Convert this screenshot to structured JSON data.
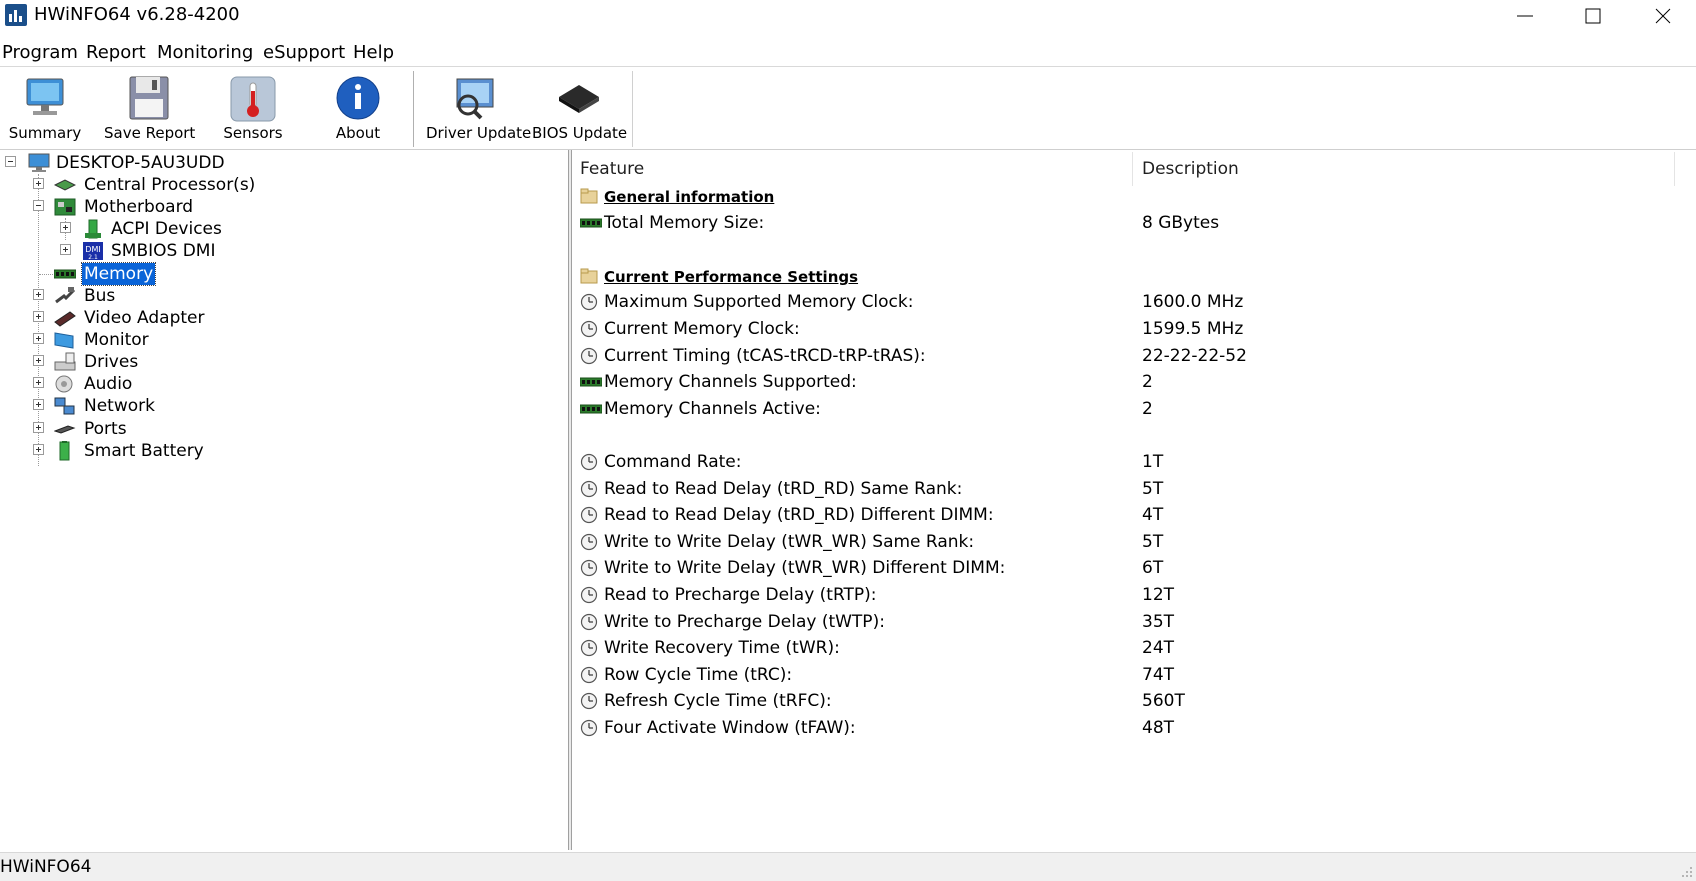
{
  "window": {
    "title": "HWiNFO64 v6.28-4200"
  },
  "menu": [
    "Program",
    "Report",
    "Monitoring",
    "eSupport",
    "Help"
  ],
  "toolbar": {
    "summary": "Summary",
    "save_report": "Save Report",
    "sensors": "Sensors",
    "about": "About",
    "driver_update": "Driver Update",
    "bios_update": "BIOS Update"
  },
  "tree": {
    "root": "DESKTOP-5AU3UDD",
    "items": [
      {
        "label": "Central Processor(s)",
        "icon": "cpu-icon"
      },
      {
        "label": "Motherboard",
        "icon": "motherboard-icon"
      },
      {
        "label": "ACPI Devices",
        "icon": "acpi-icon"
      },
      {
        "label": "SMBIOS DMI",
        "icon": "dmi-icon"
      },
      {
        "label": "Memory",
        "icon": "memory-icon",
        "selected": true
      },
      {
        "label": "Bus",
        "icon": "bus-icon"
      },
      {
        "label": "Video Adapter",
        "icon": "video-adapter-icon"
      },
      {
        "label": "Monitor",
        "icon": "monitor-icon"
      },
      {
        "label": "Drives",
        "icon": "drives-icon"
      },
      {
        "label": "Audio",
        "icon": "audio-icon"
      },
      {
        "label": "Network",
        "icon": "network-icon"
      },
      {
        "label": "Ports",
        "icon": "ports-icon"
      },
      {
        "label": "Smart Battery",
        "icon": "battery-icon"
      }
    ]
  },
  "details": {
    "columns": {
      "feature": "Feature",
      "description": "Description"
    },
    "rows": [
      {
        "type": "section",
        "feature": "General information",
        "icon": "folder-icon"
      },
      {
        "type": "item",
        "feature": "Total Memory Size:",
        "description": "8 GBytes",
        "icon": "memory-icon"
      },
      {
        "type": "blank"
      },
      {
        "type": "section",
        "feature": "Current Performance Settings",
        "icon": "folder-icon"
      },
      {
        "type": "item",
        "feature": "Maximum Supported Memory Clock:",
        "description": "1600.0 MHz",
        "icon": "clock-icon"
      },
      {
        "type": "item",
        "feature": "Current Memory Clock:",
        "description": "1599.5 MHz",
        "icon": "clock-icon"
      },
      {
        "type": "item",
        "feature": "Current Timing (tCAS-tRCD-tRP-tRAS):",
        "description": "22-22-22-52",
        "icon": "clock-icon"
      },
      {
        "type": "item",
        "feature": "Memory Channels Supported:",
        "description": "2",
        "icon": "memory-icon"
      },
      {
        "type": "item",
        "feature": "Memory Channels Active:",
        "description": "2",
        "icon": "memory-icon"
      },
      {
        "type": "blank"
      },
      {
        "type": "item",
        "feature": "Command Rate:",
        "description": "1T",
        "icon": "clock-icon"
      },
      {
        "type": "item",
        "feature": "Read to Read Delay (tRD_RD) Same Rank:",
        "description": "5T",
        "icon": "clock-icon"
      },
      {
        "type": "item",
        "feature": "Read to Read Delay (tRD_RD) Different DIMM:",
        "description": "4T",
        "icon": "clock-icon"
      },
      {
        "type": "item",
        "feature": "Write to Write Delay (tWR_WR) Same Rank:",
        "description": "5T",
        "icon": "clock-icon"
      },
      {
        "type": "item",
        "feature": "Write to Write Delay (tWR_WR) Different DIMM:",
        "description": "6T",
        "icon": "clock-icon"
      },
      {
        "type": "item",
        "feature": "Read to Precharge Delay (tRTP):",
        "description": "12T",
        "icon": "clock-icon"
      },
      {
        "type": "item",
        "feature": "Write to Precharge Delay (tWTP):",
        "description": "35T",
        "icon": "clock-icon"
      },
      {
        "type": "item",
        "feature": "Write Recovery Time (tWR):",
        "description": "24T",
        "icon": "clock-icon"
      },
      {
        "type": "item",
        "feature": "Row Cycle Time (tRC):",
        "description": "74T",
        "icon": "clock-icon"
      },
      {
        "type": "item",
        "feature": "Refresh Cycle Time (tRFC):",
        "description": "560T",
        "icon": "clock-icon"
      },
      {
        "type": "item",
        "feature": "Four Activate Window (tFAW):",
        "description": "48T",
        "icon": "clock-icon"
      }
    ]
  },
  "status": {
    "text": "HWiNFO64"
  },
  "colors": {
    "selection": "#0a64d8",
    "statusbar": "#f0f0f0"
  }
}
